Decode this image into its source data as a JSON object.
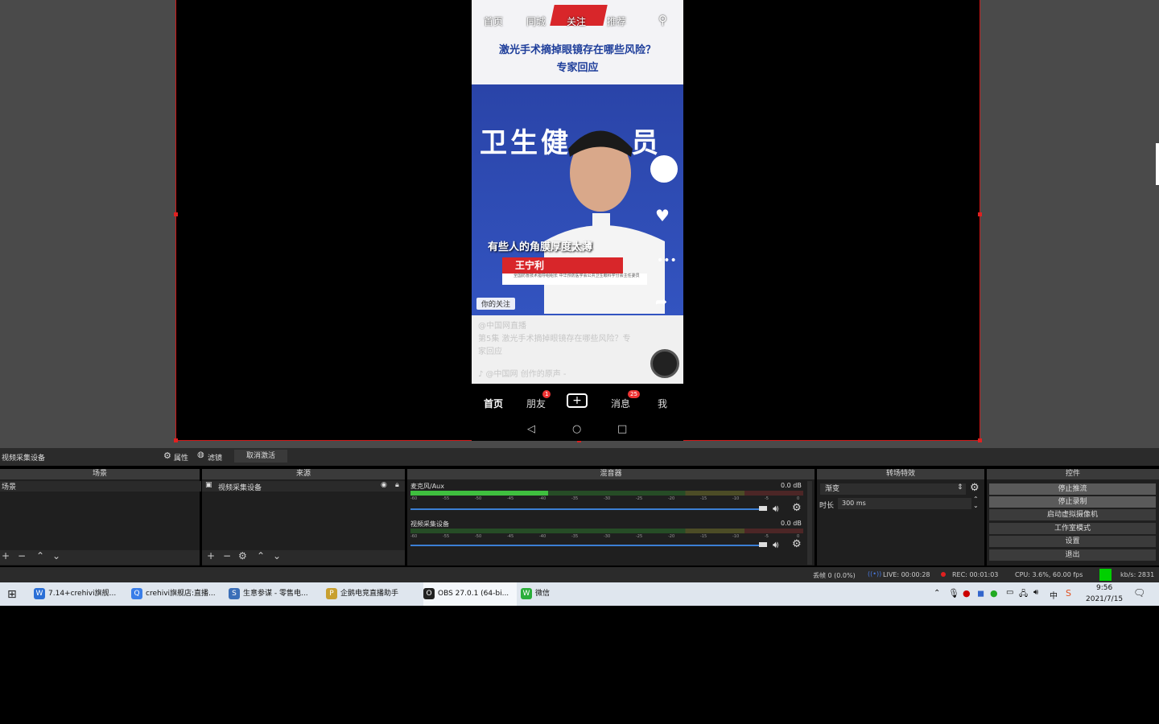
{
  "phone": {
    "top_tabs": [
      "首页",
      "同城",
      "关注",
      "推荐"
    ],
    "headline_line1": "激光手术摘掉眼镜存在哪些风险？",
    "headline_line2": "专家回应",
    "bg_text_left": "卫生健",
    "bg_text_right": "员",
    "caption": "有些人的角膜厚度太薄",
    "name_label": "王宁利",
    "name_sub": "全国防盲技术指导组组长 中华预防医学会公共卫生眼科学分会主任委员",
    "follow_tag": "你的关注",
    "account": "@中国网直播",
    "desc": "第5集 激光手术摘掉眼镜存在哪些风险？专家回应",
    "music": "♪ @中国网 创作的原声 -",
    "nav": {
      "home": "首页",
      "friends": "朋友",
      "friends_badge": "1",
      "plus": "+",
      "messages": "消息",
      "messages_badge": "25",
      "me": "我"
    }
  },
  "obs": {
    "source_title": "视频采集设备",
    "properties_btn": "属性",
    "filters_btn": "滤镜",
    "deactivate_btn": "取消激活",
    "panels": {
      "scenes": "场景",
      "sources": "来源",
      "mixer": "混音器",
      "transitions": "转场特效",
      "controls": "控件"
    },
    "scene_items": [
      "场景"
    ],
    "source_items": [
      "视频采集设备"
    ],
    "mixer": [
      {
        "name": "麦克风/Aux",
        "db": "0.0 dB",
        "level": 0.35
      },
      {
        "name": "视频采集设备",
        "db": "0.0 dB",
        "level": 0.0
      }
    ],
    "meter_ticks": [
      "-60",
      "-55",
      "-50",
      "-45",
      "-40",
      "-35",
      "-30",
      "-25",
      "-20",
      "-15",
      "-10",
      "-5",
      "0"
    ],
    "transition_value": "渐变",
    "duration_label": "时长",
    "duration_value": "300 ms",
    "controls": [
      "停止推流",
      "停止录制",
      "启动虚拟摄像机",
      "工作室模式",
      "设置",
      "退出"
    ],
    "status": {
      "dropped": "丢帧 0 (0.0%)",
      "live": "LIVE: 00:00:28",
      "rec": "REC: 00:01:03",
      "cpu": "CPU: 3.6%, 60.00 fps",
      "kbs": "kb/s: 2831"
    }
  },
  "taskbar": {
    "apps": [
      {
        "label": "7.14+crehivi旗舰...",
        "color": "#2b6fd6",
        "icon": "W"
      },
      {
        "label": "crehivi旗舰店:直播...",
        "color": "#3a7ee8",
        "icon": "Q"
      },
      {
        "label": "生意参谋 - 零售电...",
        "color": "#3b6fb8",
        "icon": "S"
      },
      {
        "label": "企鹅电竞直播助手",
        "color": "#c8a030",
        "icon": "P"
      },
      {
        "label": "OBS 27.0.1 (64-bi...",
        "color": "#222222",
        "icon": "O"
      },
      {
        "label": "微信",
        "color": "#2aae3a",
        "icon": "W"
      }
    ],
    "ime": "中",
    "time": "9:56",
    "date": "2021/7/15"
  },
  "colors": {
    "accent_red": "#d01818",
    "obs_bg": "#1f1f1f",
    "slider_blue": "#3b7fd4",
    "status_green": "#00d000"
  }
}
